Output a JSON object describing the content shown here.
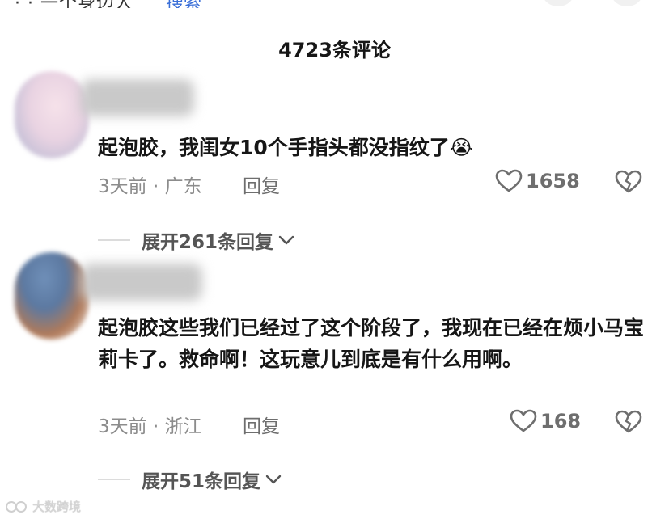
{
  "top_strip": {
    "cut_text": "· · 一个身边人",
    "cut_link": "搜索"
  },
  "header": {
    "comment_count_label": "4723条评论"
  },
  "comments": [
    {
      "text": "起泡胶，我闺女10个手指头都没指纹了😭",
      "time_location": "3天前 · 广东",
      "reply_label": "回复",
      "likes": "1658",
      "expand_label": "展开261条回复"
    },
    {
      "text": "起泡胶这些我们已经过了这个阶段了，我现在已经在烦小马宝莉卡了。救命啊！这玩意儿到底是有什么用啊。",
      "time_location": "3天前 · 浙江",
      "reply_label": "回复",
      "likes": "168",
      "expand_label": "展开51条回复"
    }
  ],
  "watermark": {
    "text": "大数跨境"
  },
  "icons": {
    "like": "heart-outline-icon",
    "dislike": "broken-heart-icon",
    "expand": "chevron-down-icon"
  },
  "colors": {
    "text_primary": "#161616",
    "text_meta": "#8c8c8c",
    "icon_gray": "#6e6e6e"
  }
}
